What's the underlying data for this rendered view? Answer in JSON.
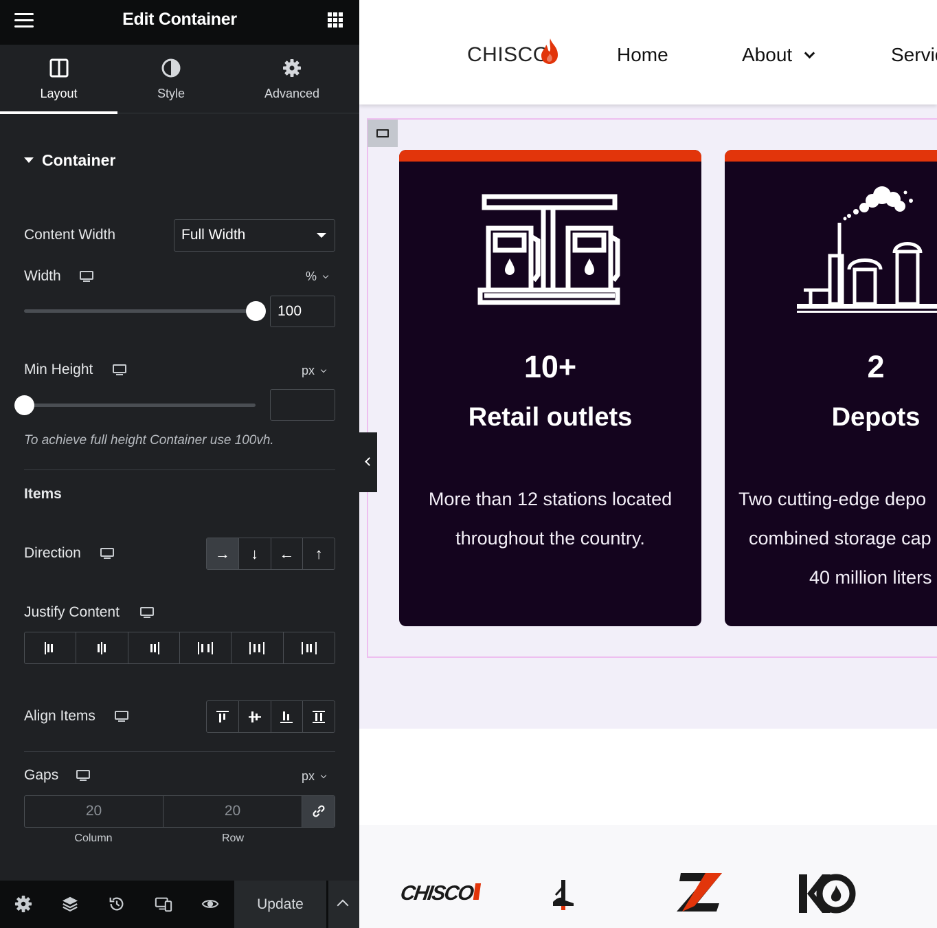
{
  "editor": {
    "title": "Edit Container",
    "tabs": [
      {
        "label": "Layout",
        "icon": "columns-icon",
        "active": true
      },
      {
        "label": "Style",
        "icon": "half-circle-icon",
        "active": false
      },
      {
        "label": "Advanced",
        "icon": "gear-icon",
        "active": false
      }
    ],
    "section_title": "Container",
    "content_width": {
      "label": "Content Width",
      "value": "Full Width"
    },
    "width": {
      "label": "Width",
      "unit": "%",
      "value": "100",
      "slider_fraction": 1.0
    },
    "min_height": {
      "label": "Min Height",
      "unit": "px",
      "value": "",
      "slider_fraction": 0.0
    },
    "hint": "To achieve full height Container use 100vh.",
    "items_title": "Items",
    "direction": {
      "label": "Direction",
      "options": [
        "→",
        "↓",
        "←",
        "↑"
      ],
      "selected": 0
    },
    "justify_content": {
      "label": "Justify Content"
    },
    "align_items": {
      "label": "Align Items"
    },
    "gaps": {
      "label": "Gaps",
      "unit": "px",
      "column_value": "20",
      "row_value": "20",
      "column_caption": "Column",
      "row_caption": "Row"
    },
    "update_label": "Update"
  },
  "site": {
    "logo_text": "CHISCO",
    "nav": {
      "home": "Home",
      "about": "About",
      "services": "Servic"
    },
    "colors": {
      "accent": "#e2350b",
      "card_bg": "#14041e",
      "section_bg": "#f2eff9"
    },
    "cards": [
      {
        "icon": "fuel-pump-icon",
        "number": "10+",
        "title": "Retail outlets",
        "desc_lines": [
          "More than 12 stations located",
          "throughout the country."
        ]
      },
      {
        "icon": "refinery-icon",
        "number": "2",
        "title": "Depots",
        "desc_lines": [
          "Two cutting-edge depo",
          "combined storage cap",
          "40 million liters"
        ]
      }
    ],
    "partners": {
      "first_logo_text": "CHISCO"
    }
  }
}
